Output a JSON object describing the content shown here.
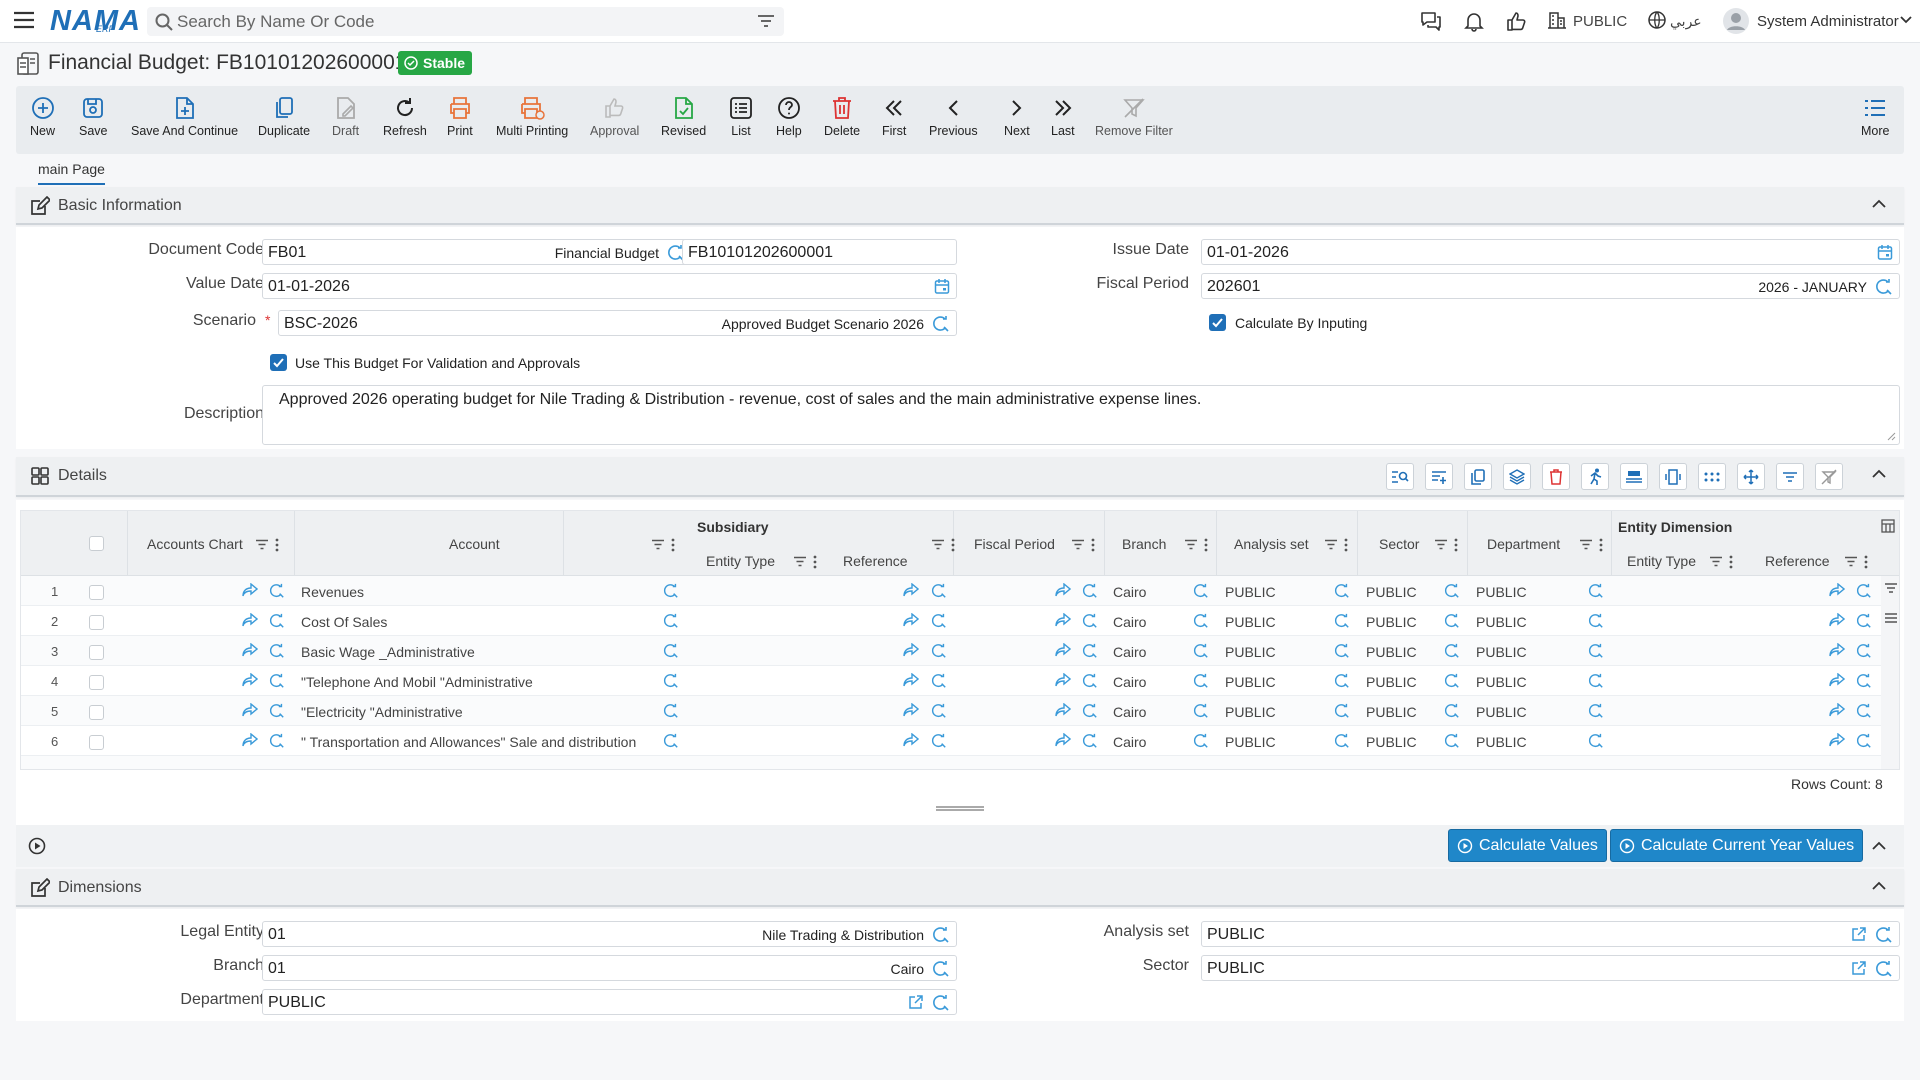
{
  "app": {
    "logo": "NAMA",
    "logo_sub": "ERP"
  },
  "search": {
    "placeholder": "Search By Name Or Code"
  },
  "topbar": {
    "public_label": "PUBLIC",
    "lang_label": "عربي",
    "user_name": "System Administrator"
  },
  "page": {
    "title": "Financial Budget: FB10101202600001",
    "status": "Stable"
  },
  "toolbar": {
    "new": "New",
    "save": "Save",
    "save_continue": "Save And Continue",
    "duplicate": "Duplicate",
    "draft": "Draft",
    "refresh": "Refresh",
    "print": "Print",
    "multi_printing": "Multi Printing",
    "approval": "Approval",
    "revised": "Revised",
    "list": "List",
    "help": "Help",
    "delete": "Delete",
    "first": "First",
    "previous": "Previous",
    "next": "Next",
    "last": "Last",
    "remove_filter": "Remove Filter",
    "more": "More"
  },
  "tabs": {
    "main": "main Page"
  },
  "basic": {
    "title": "Basic Information",
    "document_code_label": "Document Code",
    "document_code": "FB01",
    "document_code_ref": "Financial Budget",
    "document_number": "FB10101202600001",
    "value_date_label": "Value Date",
    "value_date": "01-01-2026",
    "scenario_label": "Scenario",
    "scenario": "BSC-2026",
    "scenario_ref": "Approved Budget Scenario 2026",
    "issue_date_label": "Issue Date",
    "issue_date": "01-01-2026",
    "fiscal_period_label": "Fiscal Period",
    "fiscal_period": "202601",
    "fiscal_period_ref": "2026 - JANUARY",
    "calc_by_input_label": "Calculate By Inputing",
    "use_budget_label": "Use This Budget For Validation and Approvals",
    "description_label": "Description",
    "description": "Approved 2026 operating budget for Nile Trading & Distribution - revenue, cost of sales and the main administrative expense lines."
  },
  "details": {
    "title": "Details",
    "columns": {
      "accounts_chart": "Accounts Chart",
      "account": "Account",
      "subsidiary": "Subsidiary",
      "entity_type": "Entity Type",
      "reference": "Reference",
      "fiscal_period": "Fiscal Period",
      "branch": "Branch",
      "analysis_set": "Analysis set",
      "sector": "Sector",
      "department": "Department",
      "entity_dimension": "Entity Dimension",
      "entity_type_2": "Entity Type",
      "reference_2": "Reference"
    },
    "rows": [
      {
        "n": "1",
        "account": "Revenues",
        "branch": "Cairo",
        "analysis": "PUBLIC",
        "sector": "PUBLIC",
        "department": "PUBLIC"
      },
      {
        "n": "2",
        "account": "Cost Of Sales",
        "branch": "Cairo",
        "analysis": "PUBLIC",
        "sector": "PUBLIC",
        "department": "PUBLIC"
      },
      {
        "n": "3",
        "account": "Basic Wage _Administrative",
        "branch": "Cairo",
        "analysis": "PUBLIC",
        "sector": "PUBLIC",
        "department": "PUBLIC"
      },
      {
        "n": "4",
        "account": "\"Telephone And Mobil \"Administrative",
        "branch": "Cairo",
        "analysis": "PUBLIC",
        "sector": "PUBLIC",
        "department": "PUBLIC"
      },
      {
        "n": "5",
        "account": "\"Electricity \"Administrative",
        "branch": "Cairo",
        "analysis": "PUBLIC",
        "sector": "PUBLIC",
        "department": "PUBLIC"
      },
      {
        "n": "6",
        "account": "\" Transportation and Allowances\" Sale and distribution",
        "branch": "Cairo",
        "analysis": "PUBLIC",
        "sector": "PUBLIC",
        "department": "PUBLIC"
      }
    ],
    "rows_count_label": "Rows Count: 8"
  },
  "actions": {
    "calculate_values": "Calculate Values",
    "calculate_current_year": "Calculate Current Year Values"
  },
  "dimensions": {
    "title": "Dimensions",
    "legal_entity_label": "Legal Entity",
    "legal_entity": "01",
    "legal_entity_ref": "Nile Trading & Distribution",
    "branch_label": "Branch",
    "branch": "01",
    "branch_ref": "Cairo",
    "department_label": "Department",
    "department": "PUBLIC",
    "analysis_set_label": "Analysis set",
    "analysis_set": "PUBLIC",
    "sector_label": "Sector",
    "sector": "PUBLIC"
  },
  "colors": {
    "primary": "#1f6fb7",
    "badge": "#27a745",
    "action_button": "#1f87c9",
    "delete": "#d33",
    "print": "#e8743b"
  }
}
